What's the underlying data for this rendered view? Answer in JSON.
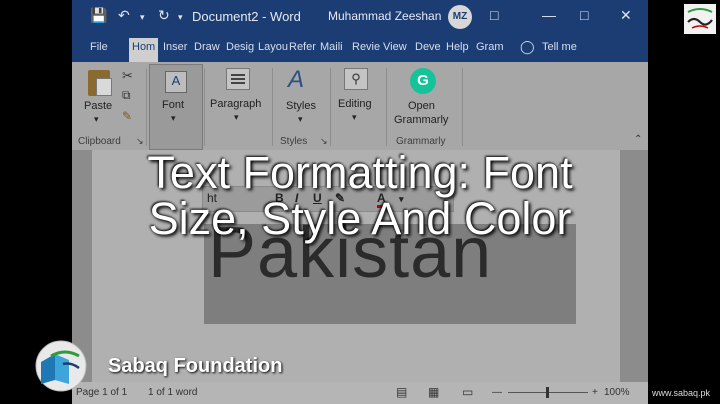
{
  "titlebar": {
    "doc_title": "Document2 - Word",
    "user": "Muhammad Zeeshan",
    "avatar_initials": "MZ"
  },
  "tabs": [
    "File",
    "Hom",
    "Inser",
    "Draw",
    "Desig",
    "Layou",
    "Refer",
    "Maili",
    "Revie",
    "View",
    "Deve",
    "Help",
    "Gram",
    "Tell me"
  ],
  "ribbon": {
    "paste": "Paste",
    "clipboard": "Clipboard",
    "font": "Font",
    "paragraph": "Paragraph",
    "styles_btn": "Styles",
    "styles_grp": "Styles",
    "editing": "Editing",
    "open_grammarly_1": "Open",
    "open_grammarly_2": "Grammarly",
    "grammarly_grp": "Grammarly"
  },
  "document": {
    "big_text": "Pakistan",
    "mini_toolbar_label": "ht"
  },
  "statusbar": {
    "page": "Page 1 of 1",
    "words": "1 of 1 word",
    "zoom": "100%"
  },
  "overlay": {
    "title_line1": "Text Formatting: Font",
    "title_line2": "Size, Style And Color",
    "brand": "Sabaq Foundation",
    "url": "www.sabaq.pk"
  },
  "colors": {
    "titlebar": "#1c3d73",
    "grammarly_green": "#15c39a",
    "font_red": "#c00000"
  }
}
